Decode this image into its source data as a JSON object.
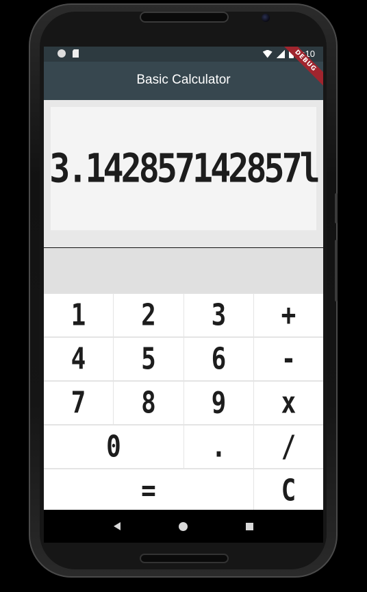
{
  "status_bar": {
    "time": "1:10",
    "icons": [
      "notification-dot-icon",
      "sd-card-icon",
      "wifi-icon",
      "signal-icon",
      "battery-icon"
    ]
  },
  "app_bar": {
    "title": "Basic Calculator",
    "debug_banner": "DEBUG",
    "color": "#37474f"
  },
  "display": {
    "value": "3.142857142857l"
  },
  "history": {
    "text": ""
  },
  "keypad": {
    "keys": [
      {
        "label": "1",
        "name": "key-1"
      },
      {
        "label": "2",
        "name": "key-2"
      },
      {
        "label": "3",
        "name": "key-3"
      },
      {
        "label": "+",
        "name": "key-plus"
      },
      {
        "label": "4",
        "name": "key-4"
      },
      {
        "label": "5",
        "name": "key-5"
      },
      {
        "label": "6",
        "name": "key-6"
      },
      {
        "label": "-",
        "name": "key-minus"
      },
      {
        "label": "7",
        "name": "key-7"
      },
      {
        "label": "8",
        "name": "key-8"
      },
      {
        "label": "9",
        "name": "key-9"
      },
      {
        "label": "x",
        "name": "key-multiply"
      },
      {
        "label": "0",
        "name": "key-0"
      },
      {
        "label": ".",
        "name": "key-decimal"
      },
      {
        "label": "/",
        "name": "key-divide"
      },
      {
        "label": "=",
        "name": "key-equals"
      },
      {
        "label": "C",
        "name": "key-clear"
      }
    ]
  },
  "nav_bar": {
    "icons": [
      "back-icon",
      "home-icon",
      "recents-icon"
    ]
  }
}
